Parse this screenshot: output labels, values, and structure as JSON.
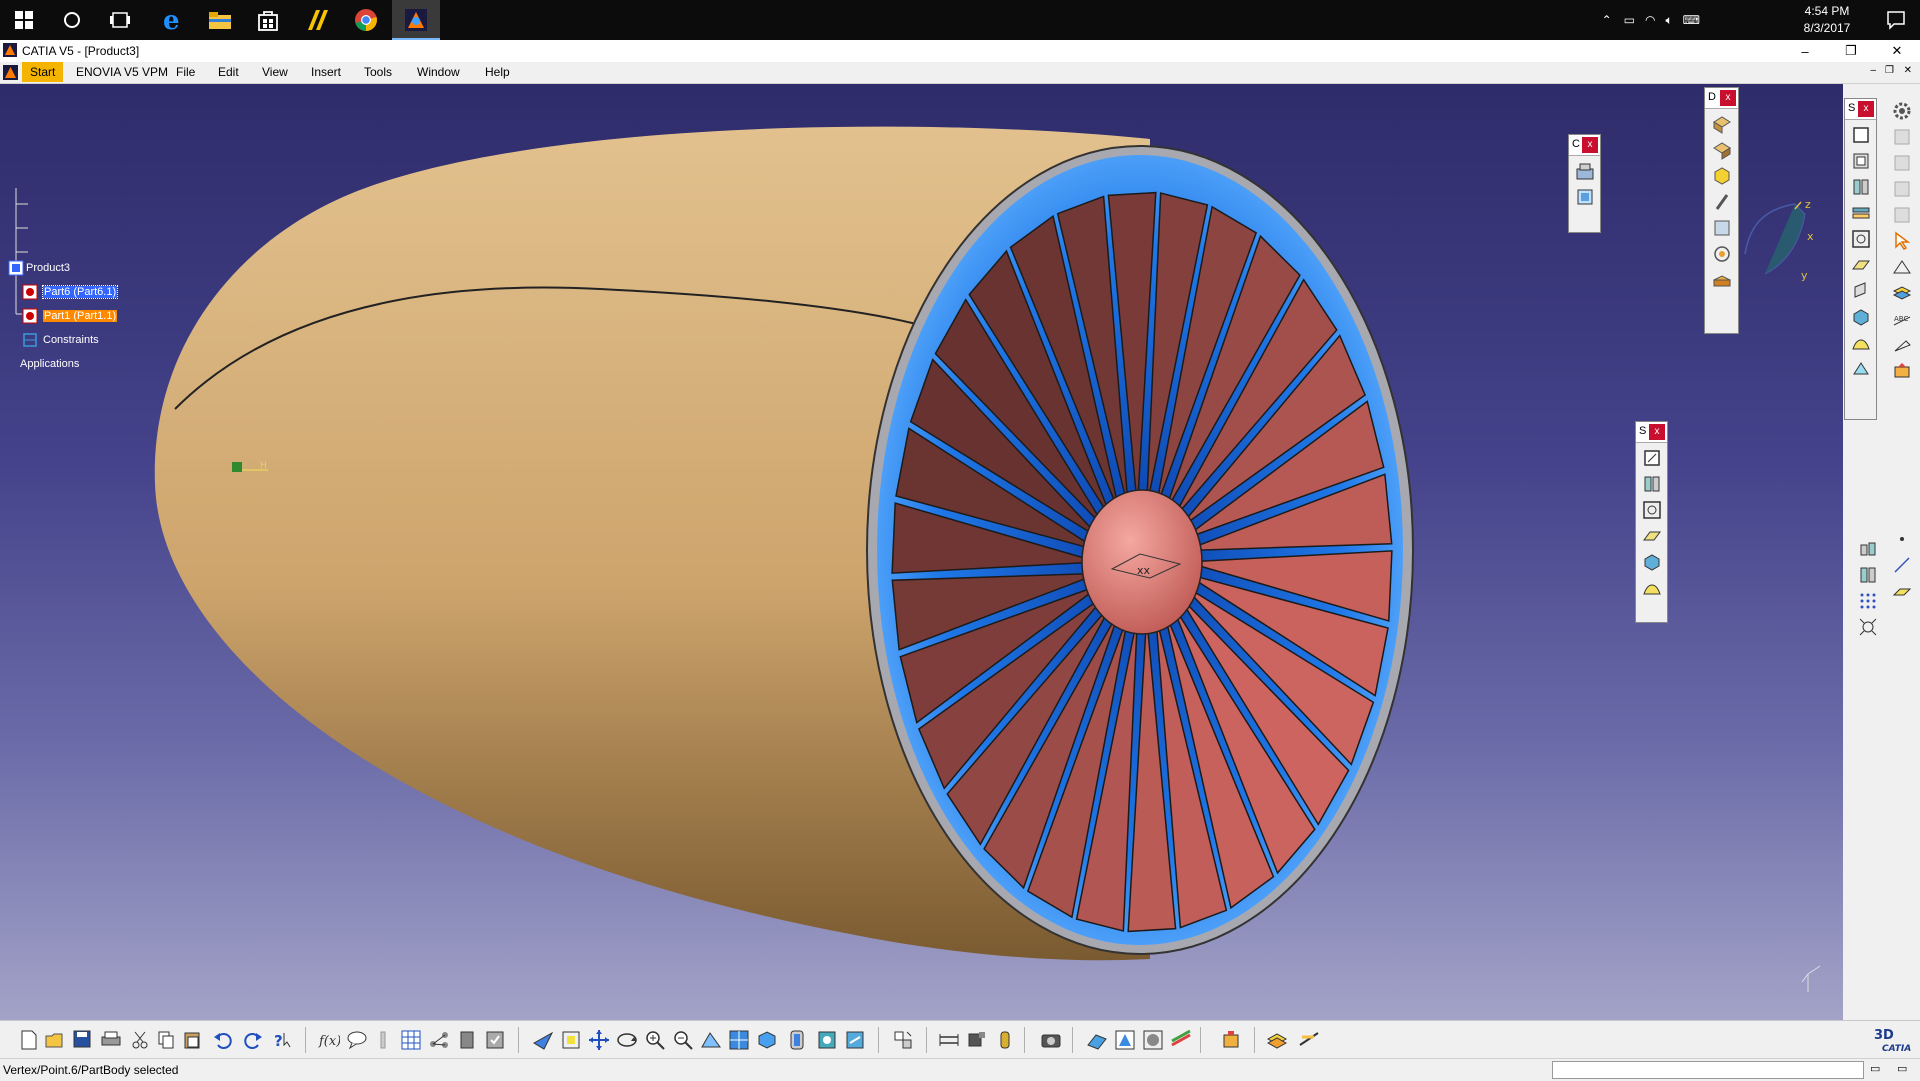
{
  "taskbar": {
    "apps": [
      "windows-start",
      "cortana-search",
      "task-view",
      "edge",
      "file-explorer",
      "store",
      "app-6",
      "chrome",
      "catia"
    ],
    "clock_time": "4:54 PM",
    "clock_date": "8/3/2017"
  },
  "window": {
    "title": "CATIA V5 - [Product3]",
    "minimize": "–",
    "maximize": "❐",
    "close": "✕"
  },
  "menu": {
    "start": "Start",
    "enovia": "ENOVIA V5 VPM",
    "file": "File",
    "edit": "Edit",
    "view": "View",
    "insert": "Insert",
    "tools": "Tools",
    "window": "Window",
    "help": "Help"
  },
  "tree": {
    "root": "Product3",
    "part6": "Part6 (Part6.1)",
    "part1": "Part1 (Part1.1)",
    "constraints": "Constraints",
    "applications": "Applications"
  },
  "toolbars": {
    "float1_title": "C",
    "float2_title": "D",
    "float3_title": "S",
    "float4_title": "S",
    "close_glyph": "x"
  },
  "compass": {
    "x": "x",
    "y": "y",
    "z": "z"
  },
  "status": {
    "text": "Vertex/Point.6/PartBody selected"
  },
  "colors": {
    "nacelle": "#d4b27e",
    "blade": "#c25a55",
    "fan_case": "#1e6fe0",
    "selection_blue": "#3366ff",
    "selection_orange": "#ff8a00"
  }
}
